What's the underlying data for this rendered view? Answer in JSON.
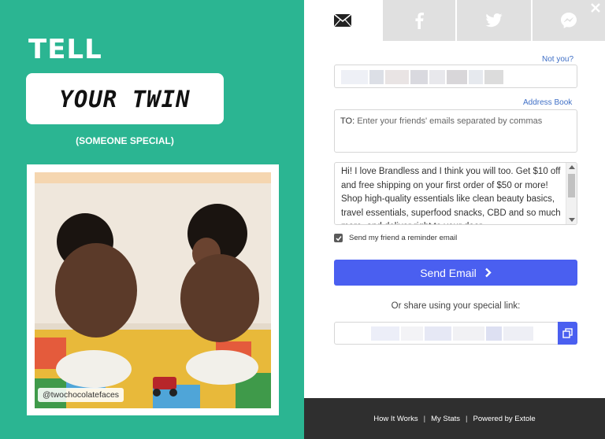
{
  "promo": {
    "line1": "TELL",
    "line2": "YOUR TWIN",
    "subline": "(SOMEONE SPECIAL)",
    "photo_credit": "@twochocolatefaces"
  },
  "tabs": [
    {
      "name": "email",
      "icon": "envelope-icon",
      "active": true
    },
    {
      "name": "facebook",
      "icon": "facebook-icon",
      "active": false
    },
    {
      "name": "twitter",
      "icon": "twitter-icon",
      "active": false
    },
    {
      "name": "messenger",
      "icon": "messenger-icon",
      "active": false
    }
  ],
  "form": {
    "not_you_link": "Not you?",
    "address_book_link": "Address Book",
    "to_label": "TO:",
    "to_placeholder": "Enter your friends' emails separated by commas",
    "message": "Hi! I love Brandless and I think you will too. Get $10 off and free shipping on your first order of $50 or more! Shop high-quality essentials like clean beauty basics, travel essentials, superfood snacks, CBD and so much more, and deliver right to your door.",
    "reminder_label": "Send my friend a reminder email",
    "reminder_checked": true,
    "send_button": "Send Email",
    "share_text": "Or share using your special link:"
  },
  "footer": {
    "how_it_works": "How It Works",
    "my_stats": "My Stats",
    "powered_by": "Powered by Extole",
    "separator": "|"
  },
  "colors": {
    "promo_bg": "#2bb592",
    "accent": "#4a5ff0",
    "footer_bg": "#2f2f2f",
    "link": "#3f6fc6"
  }
}
